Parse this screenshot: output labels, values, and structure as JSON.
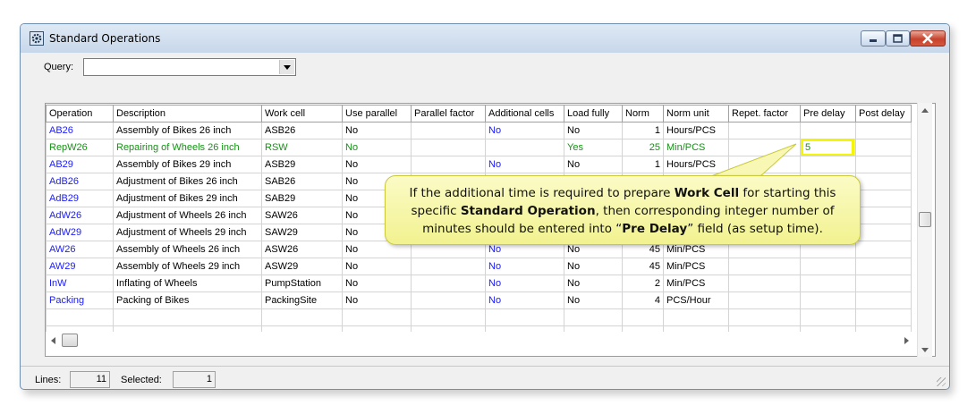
{
  "window": {
    "title": "Standard Operations"
  },
  "query": {
    "label": "Query:",
    "value": ""
  },
  "table": {
    "columns": [
      "Operation",
      "Description",
      "Work cell",
      "Use parallel",
      "Parallel factor",
      "Additional cells",
      "Load fully",
      "Norm",
      "Norm unit",
      "Repet. factor",
      "Pre delay",
      "Post delay"
    ],
    "rows": [
      {
        "operation": "AB26",
        "description": "Assembly of Bikes 26 inch",
        "work_cell": "ASB26",
        "use_parallel": "No",
        "parallel_factor": "",
        "additional_cells": "No",
        "load_fully": "No",
        "norm": "1",
        "norm_unit": "Hours/PCS",
        "repet_factor": "",
        "pre_delay": "",
        "post_delay": ""
      },
      {
        "operation": "RepW26",
        "description": "Repairing of Wheels 26 inch",
        "work_cell": "RSW",
        "use_parallel": "No",
        "parallel_factor": "",
        "additional_cells": "",
        "load_fully": "Yes",
        "norm": "25",
        "norm_unit": "Min/PCS",
        "repet_factor": "",
        "pre_delay": "5",
        "post_delay": ""
      },
      {
        "operation": "AB29",
        "description": "Assembly of Bikes 29 inch",
        "work_cell": "ASB29",
        "use_parallel": "No",
        "parallel_factor": "",
        "additional_cells": "No",
        "load_fully": "No",
        "norm": "1",
        "norm_unit": "Hours/PCS",
        "repet_factor": "",
        "pre_delay": "",
        "post_delay": ""
      },
      {
        "operation": "AdB26",
        "description": "Adjustment of Bikes 26 inch",
        "work_cell": "SAB26",
        "use_parallel": "No",
        "parallel_factor": "",
        "additional_cells": "",
        "load_fully": "",
        "norm": "",
        "norm_unit": "",
        "repet_factor": "",
        "pre_delay": "",
        "post_delay": ""
      },
      {
        "operation": "AdB29",
        "description": "Adjustment of Bikes 29 inch",
        "work_cell": "SAB29",
        "use_parallel": "No",
        "parallel_factor": "",
        "additional_cells": "",
        "load_fully": "",
        "norm": "",
        "norm_unit": "",
        "repet_factor": "",
        "pre_delay": "",
        "post_delay": ""
      },
      {
        "operation": "AdW26",
        "description": "Adjustment of Wheels 26 inch",
        "work_cell": "SAW26",
        "use_parallel": "No",
        "parallel_factor": "",
        "additional_cells": "",
        "load_fully": "",
        "norm": "",
        "norm_unit": "",
        "repet_factor": "",
        "pre_delay": "",
        "post_delay": ""
      },
      {
        "operation": "AdW29",
        "description": "Adjustment of Wheels 29 inch",
        "work_cell": "SAW29",
        "use_parallel": "No",
        "parallel_factor": "",
        "additional_cells": "",
        "load_fully": "",
        "norm": "",
        "norm_unit": "",
        "repet_factor": "",
        "pre_delay": "",
        "post_delay": ""
      },
      {
        "operation": "AW26",
        "description": "Assembly of Wheels 26 inch",
        "work_cell": "ASW26",
        "use_parallel": "No",
        "parallel_factor": "",
        "additional_cells": "No",
        "load_fully": "No",
        "norm": "45",
        "norm_unit": "Min/PCS",
        "repet_factor": "",
        "pre_delay": "",
        "post_delay": ""
      },
      {
        "operation": "AW29",
        "description": "Assembly of Wheels 29 inch",
        "work_cell": "ASW29",
        "use_parallel": "No",
        "parallel_factor": "",
        "additional_cells": "No",
        "load_fully": "No",
        "norm": "45",
        "norm_unit": "Min/PCS",
        "repet_factor": "",
        "pre_delay": "",
        "post_delay": ""
      },
      {
        "operation": "InW",
        "description": "Inflating of Wheels",
        "work_cell": "PumpStation",
        "use_parallel": "No",
        "parallel_factor": "",
        "additional_cells": "No",
        "load_fully": "No",
        "norm": "2",
        "norm_unit": "Min/PCS",
        "repet_factor": "",
        "pre_delay": "",
        "post_delay": ""
      },
      {
        "operation": "Packing",
        "description": "Packing of Bikes",
        "work_cell": "PackingSite",
        "use_parallel": "No",
        "parallel_factor": "",
        "additional_cells": "No",
        "load_fully": "No",
        "norm": "4",
        "norm_unit": "PCS/Hour",
        "repet_factor": "",
        "pre_delay": "",
        "post_delay": ""
      }
    ]
  },
  "status": {
    "lines_label": "Lines:",
    "lines_value": "11",
    "selected_label": "Selected:",
    "selected_value": "1"
  },
  "callout": {
    "t1": "If the additional time is required to prepare ",
    "b1": "Work Cell",
    "t2": " for starting this specific ",
    "b2": "Standard Operation",
    "t3": ", then corresponding integer number of minutes should be entered into “",
    "b3": "Pre Delay",
    "t4": "” field (as setup time)."
  },
  "colors": {
    "link_blue": "#1a1aff",
    "selected_green": "#139413",
    "callout_fill": "#f7f7a8",
    "highlight_yellow": "#f5f50a"
  }
}
